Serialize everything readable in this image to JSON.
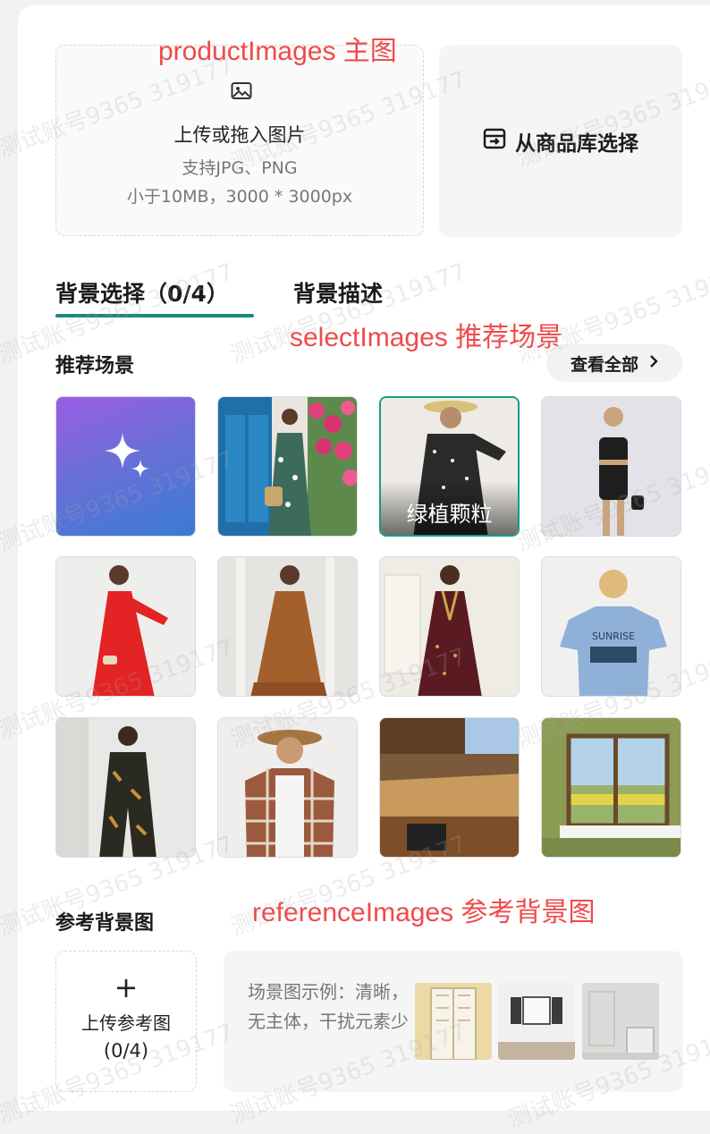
{
  "annotations": {
    "product": "productImages 主图",
    "select": "selectImages 推荐场景",
    "reference": "referenceImages 参考背景图"
  },
  "upload": {
    "title": "上传或拖入图片",
    "formats": "支持JPG、PNG",
    "limits": "小于10MB，3000 * 3000px",
    "icon": "image-icon"
  },
  "library": {
    "label": "从商品库选择",
    "icon": "import-box-icon"
  },
  "tabs": [
    {
      "label": "背景选择（0/4）",
      "active": true
    },
    {
      "label": "背景描述",
      "active": false
    }
  ],
  "scenes": {
    "title": "推荐场景",
    "view_all": "查看全部",
    "tiles": [
      {
        "name": "ai-generate",
        "caption": ""
      },
      {
        "name": "floral-dress-blue-door",
        "caption": ""
      },
      {
        "name": "polka-dress-hat",
        "caption": "绿植颗粒",
        "selected": true
      },
      {
        "name": "black-cutout-dress",
        "caption": ""
      },
      {
        "name": "red-dress",
        "caption": ""
      },
      {
        "name": "brown-dress",
        "caption": ""
      },
      {
        "name": "burgundy-dress",
        "caption": ""
      },
      {
        "name": "blue-tshirt",
        "caption": ""
      },
      {
        "name": "leaf-jumpsuit",
        "caption": ""
      },
      {
        "name": "plaid-shirt-hat",
        "caption": ""
      },
      {
        "name": "kitchen-counter",
        "caption": ""
      },
      {
        "name": "window-view",
        "caption": ""
      }
    ]
  },
  "reference": {
    "title": "参考背景图",
    "upload_plus": "+",
    "upload_label": "上传参考图",
    "upload_count": "(0/4)",
    "hint": "场景图示例：清晰，无主体，干扰元素少",
    "examples": [
      "yellow-door",
      "white-window",
      "white-room"
    ]
  },
  "watermark": "测试账号9365 319177",
  "colors": {
    "accent": "#1a8a7d",
    "annotation": "#f04a4a",
    "ai_gradient_top": "#9b5de5",
    "ai_gradient_bottom": "#3a7bd5"
  }
}
